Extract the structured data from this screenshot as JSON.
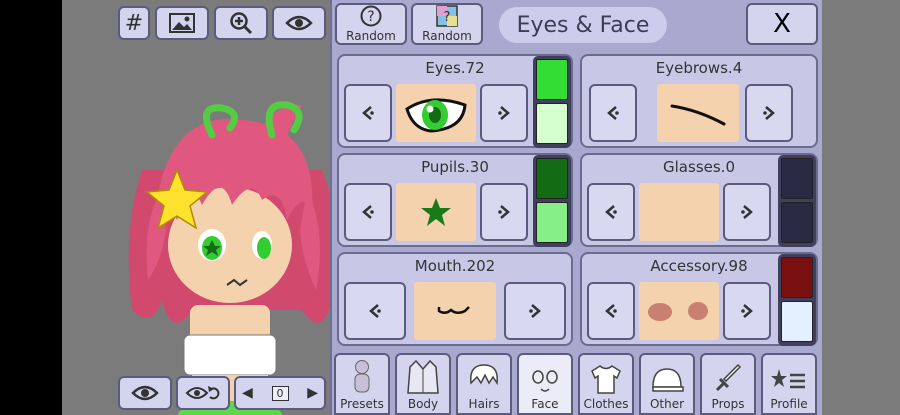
{
  "toolbar": {
    "hash_label": "#",
    "icons": [
      "hash-icon",
      "image-icon",
      "zoom-in-icon",
      "eye-icon"
    ]
  },
  "bottom_left": {
    "icons": [
      "eye-icon",
      "eye-rotate-icon",
      "chevron-left-icon",
      "chevron-right-icon"
    ],
    "layer_value": "0"
  },
  "panel": {
    "random1_label": "Random",
    "random2_label": "Random",
    "title": "Eyes & Face",
    "close_label": "X"
  },
  "cards": {
    "eyes": {
      "title": "Eyes.72",
      "colors": [
        "#33dd33",
        "#d6ffd0"
      ]
    },
    "eyebrows": {
      "title": "Eyebrows.4"
    },
    "pupils": {
      "title": "Pupils.30",
      "colors": [
        "#136b13",
        "#88ee88"
      ]
    },
    "glasses": {
      "title": "Glasses.0",
      "colors": [
        "#2a2a44",
        "#2a2a44"
      ]
    },
    "mouth": {
      "title": "Mouth.202"
    },
    "accessory": {
      "title": "Accessory.98",
      "colors": [
        "#7a1010",
        "#e2f0ff"
      ]
    }
  },
  "nav": [
    {
      "label": "Presets",
      "icon": "person-icon"
    },
    {
      "label": "Body",
      "icon": "jacket-icon"
    },
    {
      "label": "Hairs",
      "icon": "hair-icon"
    },
    {
      "label": "Face",
      "icon": "face-icon",
      "active": true
    },
    {
      "label": "Clothes",
      "icon": "shirt-icon"
    },
    {
      "label": "Other",
      "icon": "cap-icon"
    },
    {
      "label": "Props",
      "icon": "sword-icon"
    },
    {
      "label": "Profile",
      "icon": "star-list-icon"
    }
  ]
}
